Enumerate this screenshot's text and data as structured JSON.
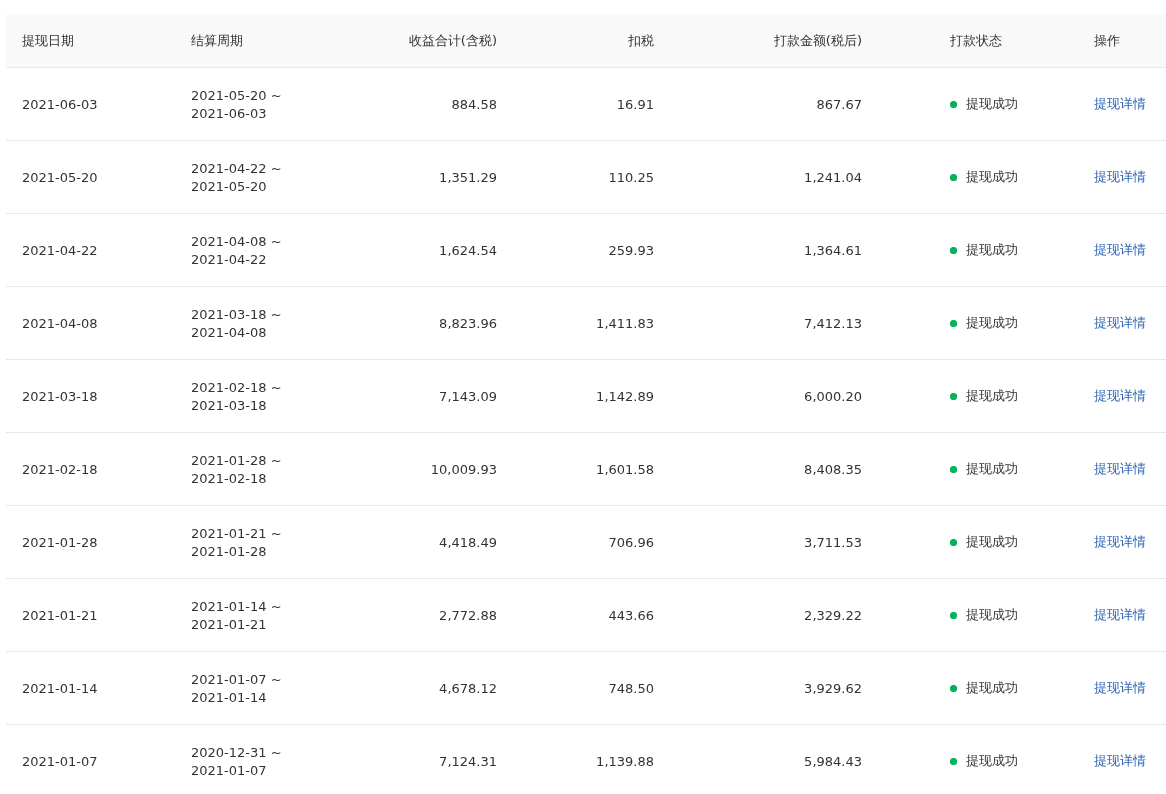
{
  "table": {
    "columns": [
      "提现日期",
      "结算周期",
      "收益合计(含税)",
      "扣税",
      "打款金额(税后)",
      "打款状态",
      "操作"
    ],
    "rows": [
      {
        "date": "2021-06-03",
        "period_start": "2021-05-20 ~",
        "period_end": "2021-06-03",
        "gross": "884.58",
        "tax": "16.91",
        "net": "867.67",
        "status": "提现成功",
        "action": "提现详情"
      },
      {
        "date": "2021-05-20",
        "period_start": "2021-04-22 ~",
        "period_end": "2021-05-20",
        "gross": "1,351.29",
        "tax": "110.25",
        "net": "1,241.04",
        "status": "提现成功",
        "action": "提现详情"
      },
      {
        "date": "2021-04-22",
        "period_start": "2021-04-08 ~",
        "period_end": "2021-04-22",
        "gross": "1,624.54",
        "tax": "259.93",
        "net": "1,364.61",
        "status": "提现成功",
        "action": "提现详情"
      },
      {
        "date": "2021-04-08",
        "period_start": "2021-03-18 ~",
        "period_end": "2021-04-08",
        "gross": "8,823.96",
        "tax": "1,411.83",
        "net": "7,412.13",
        "status": "提现成功",
        "action": "提现详情"
      },
      {
        "date": "2021-03-18",
        "period_start": "2021-02-18 ~",
        "period_end": "2021-03-18",
        "gross": "7,143.09",
        "tax": "1,142.89",
        "net": "6,000.20",
        "status": "提现成功",
        "action": "提现详情"
      },
      {
        "date": "2021-02-18",
        "period_start": "2021-01-28 ~",
        "period_end": "2021-02-18",
        "gross": "10,009.93",
        "tax": "1,601.58",
        "net": "8,408.35",
        "status": "提现成功",
        "action": "提现详情"
      },
      {
        "date": "2021-01-28",
        "period_start": "2021-01-21 ~",
        "period_end": "2021-01-28",
        "gross": "4,418.49",
        "tax": "706.96",
        "net": "3,711.53",
        "status": "提现成功",
        "action": "提现详情"
      },
      {
        "date": "2021-01-21",
        "period_start": "2021-01-14 ~",
        "period_end": "2021-01-21",
        "gross": "2,772.88",
        "tax": "443.66",
        "net": "2,329.22",
        "status": "提现成功",
        "action": "提现详情"
      },
      {
        "date": "2021-01-14",
        "period_start": "2021-01-07 ~",
        "period_end": "2021-01-14",
        "gross": "4,678.12",
        "tax": "748.50",
        "net": "3,929.62",
        "status": "提现成功",
        "action": "提现详情"
      },
      {
        "date": "2021-01-07",
        "period_start": "2020-12-31 ~",
        "period_end": "2021-01-07",
        "gross": "7,124.31",
        "tax": "1,139.88",
        "net": "5,984.43",
        "status": "提现成功",
        "action": "提现详情"
      }
    ]
  }
}
